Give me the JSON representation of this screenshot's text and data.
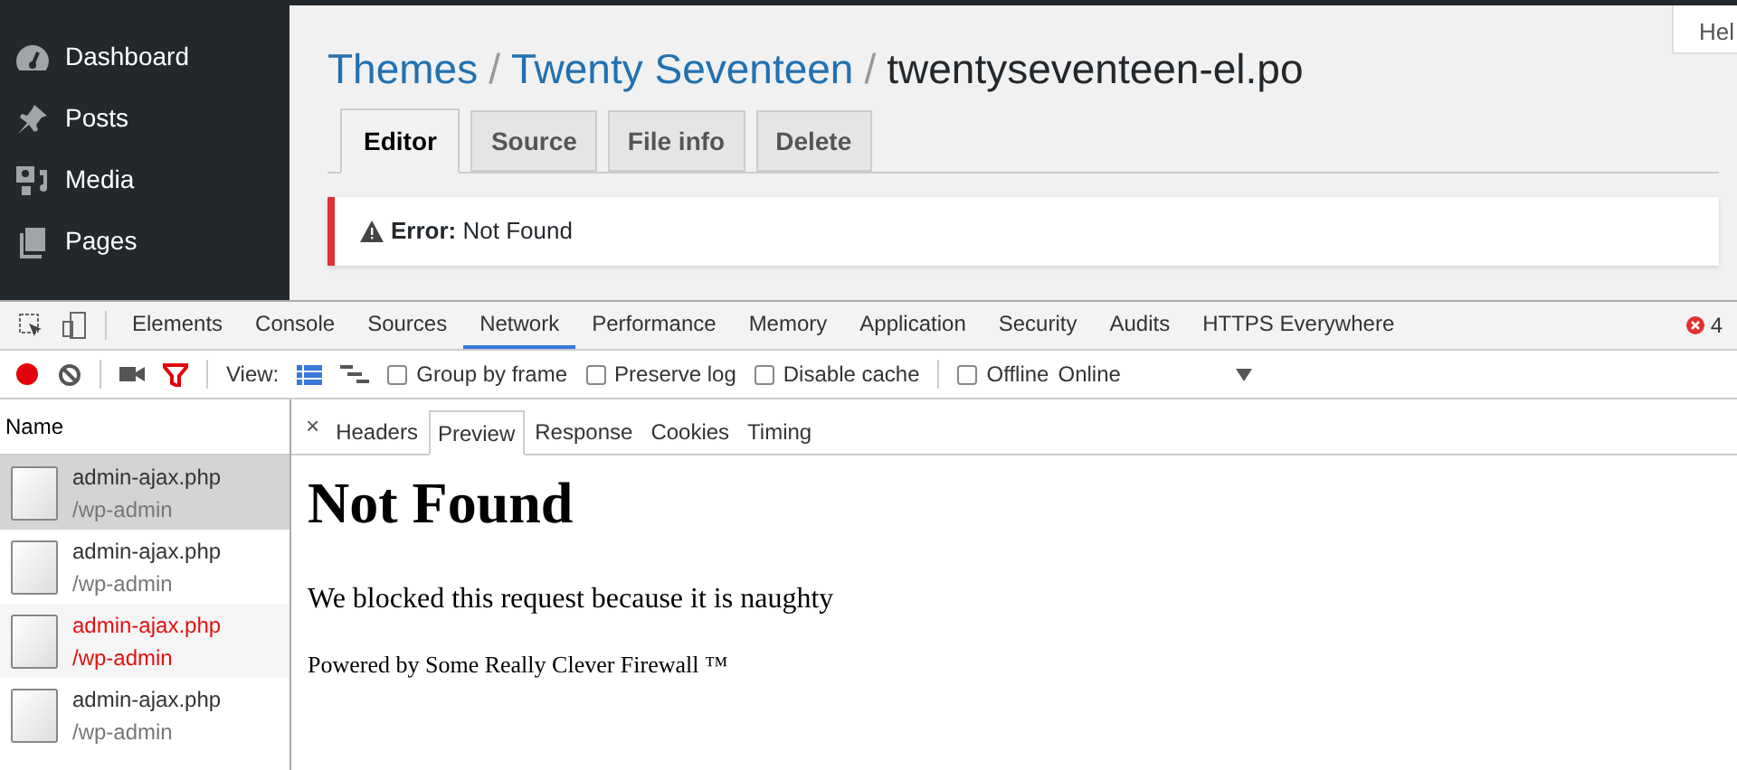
{
  "sidebar": {
    "items": [
      {
        "label": "Dashboard",
        "kind": "dashboard"
      },
      {
        "label": "Posts",
        "kind": "pin"
      },
      {
        "label": "Media",
        "kind": "media"
      },
      {
        "label": "Pages",
        "kind": "pages"
      }
    ]
  },
  "help_button": "Hel",
  "title": {
    "crumbs": [
      {
        "label": "Themes",
        "separator": "/"
      },
      {
        "label": "Twenty Seventeen",
        "separator": "/"
      }
    ],
    "current": "twentyseventeen-el.po"
  },
  "tabs": [
    {
      "label": "Editor",
      "selected": true
    },
    {
      "label": "Source",
      "selected": false
    },
    {
      "label": "File info",
      "selected": false
    },
    {
      "label": "Delete",
      "selected": false
    }
  ],
  "notice": {
    "text": "**Error:** Not Found"
  },
  "devtools": {
    "panels": [
      {
        "label": "Elements",
        "selected": false
      },
      {
        "label": "Console",
        "selected": false
      },
      {
        "label": "Sources",
        "selected": false
      },
      {
        "label": "Network",
        "selected": true
      },
      {
        "label": "Performance",
        "selected": false
      },
      {
        "label": "Memory",
        "selected": false
      },
      {
        "label": "Application",
        "selected": false
      },
      {
        "label": "Security",
        "selected": false
      },
      {
        "label": "Audits",
        "selected": false
      },
      {
        "label": "HTTPS Everywhere",
        "selected": false
      }
    ],
    "error_count": "4",
    "toolbar": {
      "recording": true,
      "filter_active": true,
      "view_label": "View:",
      "views": [
        {
          "kind": "list",
          "selected": true
        },
        {
          "kind": "waterfall",
          "selected": false
        }
      ],
      "checkboxes": [
        {
          "label": "Group by frame",
          "checked": false
        },
        {
          "label": "Preserve log",
          "checked": false
        },
        {
          "label": "Disable cache",
          "checked": false
        },
        {
          "label": "Offline",
          "checked": false
        }
      ],
      "throttling": "Online"
    },
    "name_header": "Name",
    "requests": [
      {
        "name": "admin-ajax.php",
        "path": "/wp-admin",
        "selected": true,
        "error": false
      },
      {
        "name": "admin-ajax.php",
        "path": "/wp-admin",
        "selected": false,
        "error": false
      },
      {
        "name": "admin-ajax.php",
        "path": "/wp-admin",
        "selected": false,
        "error": true
      },
      {
        "name": "admin-ajax.php",
        "path": "/wp-admin",
        "selected": false,
        "error": false
      }
    ],
    "close": "×",
    "detail_tabs": [
      {
        "label": "Headers",
        "selected": false
      },
      {
        "label": "Preview",
        "selected": true
      },
      {
        "label": "Response",
        "selected": false
      },
      {
        "label": "Cookies",
        "selected": false
      },
      {
        "label": "Timing",
        "selected": false
      }
    ],
    "preview": {
      "heading": "Not Found",
      "paragraph": "We blocked this request because it is naughty",
      "footer": "Powered by Some Really Clever Firewall ™"
    }
  }
}
